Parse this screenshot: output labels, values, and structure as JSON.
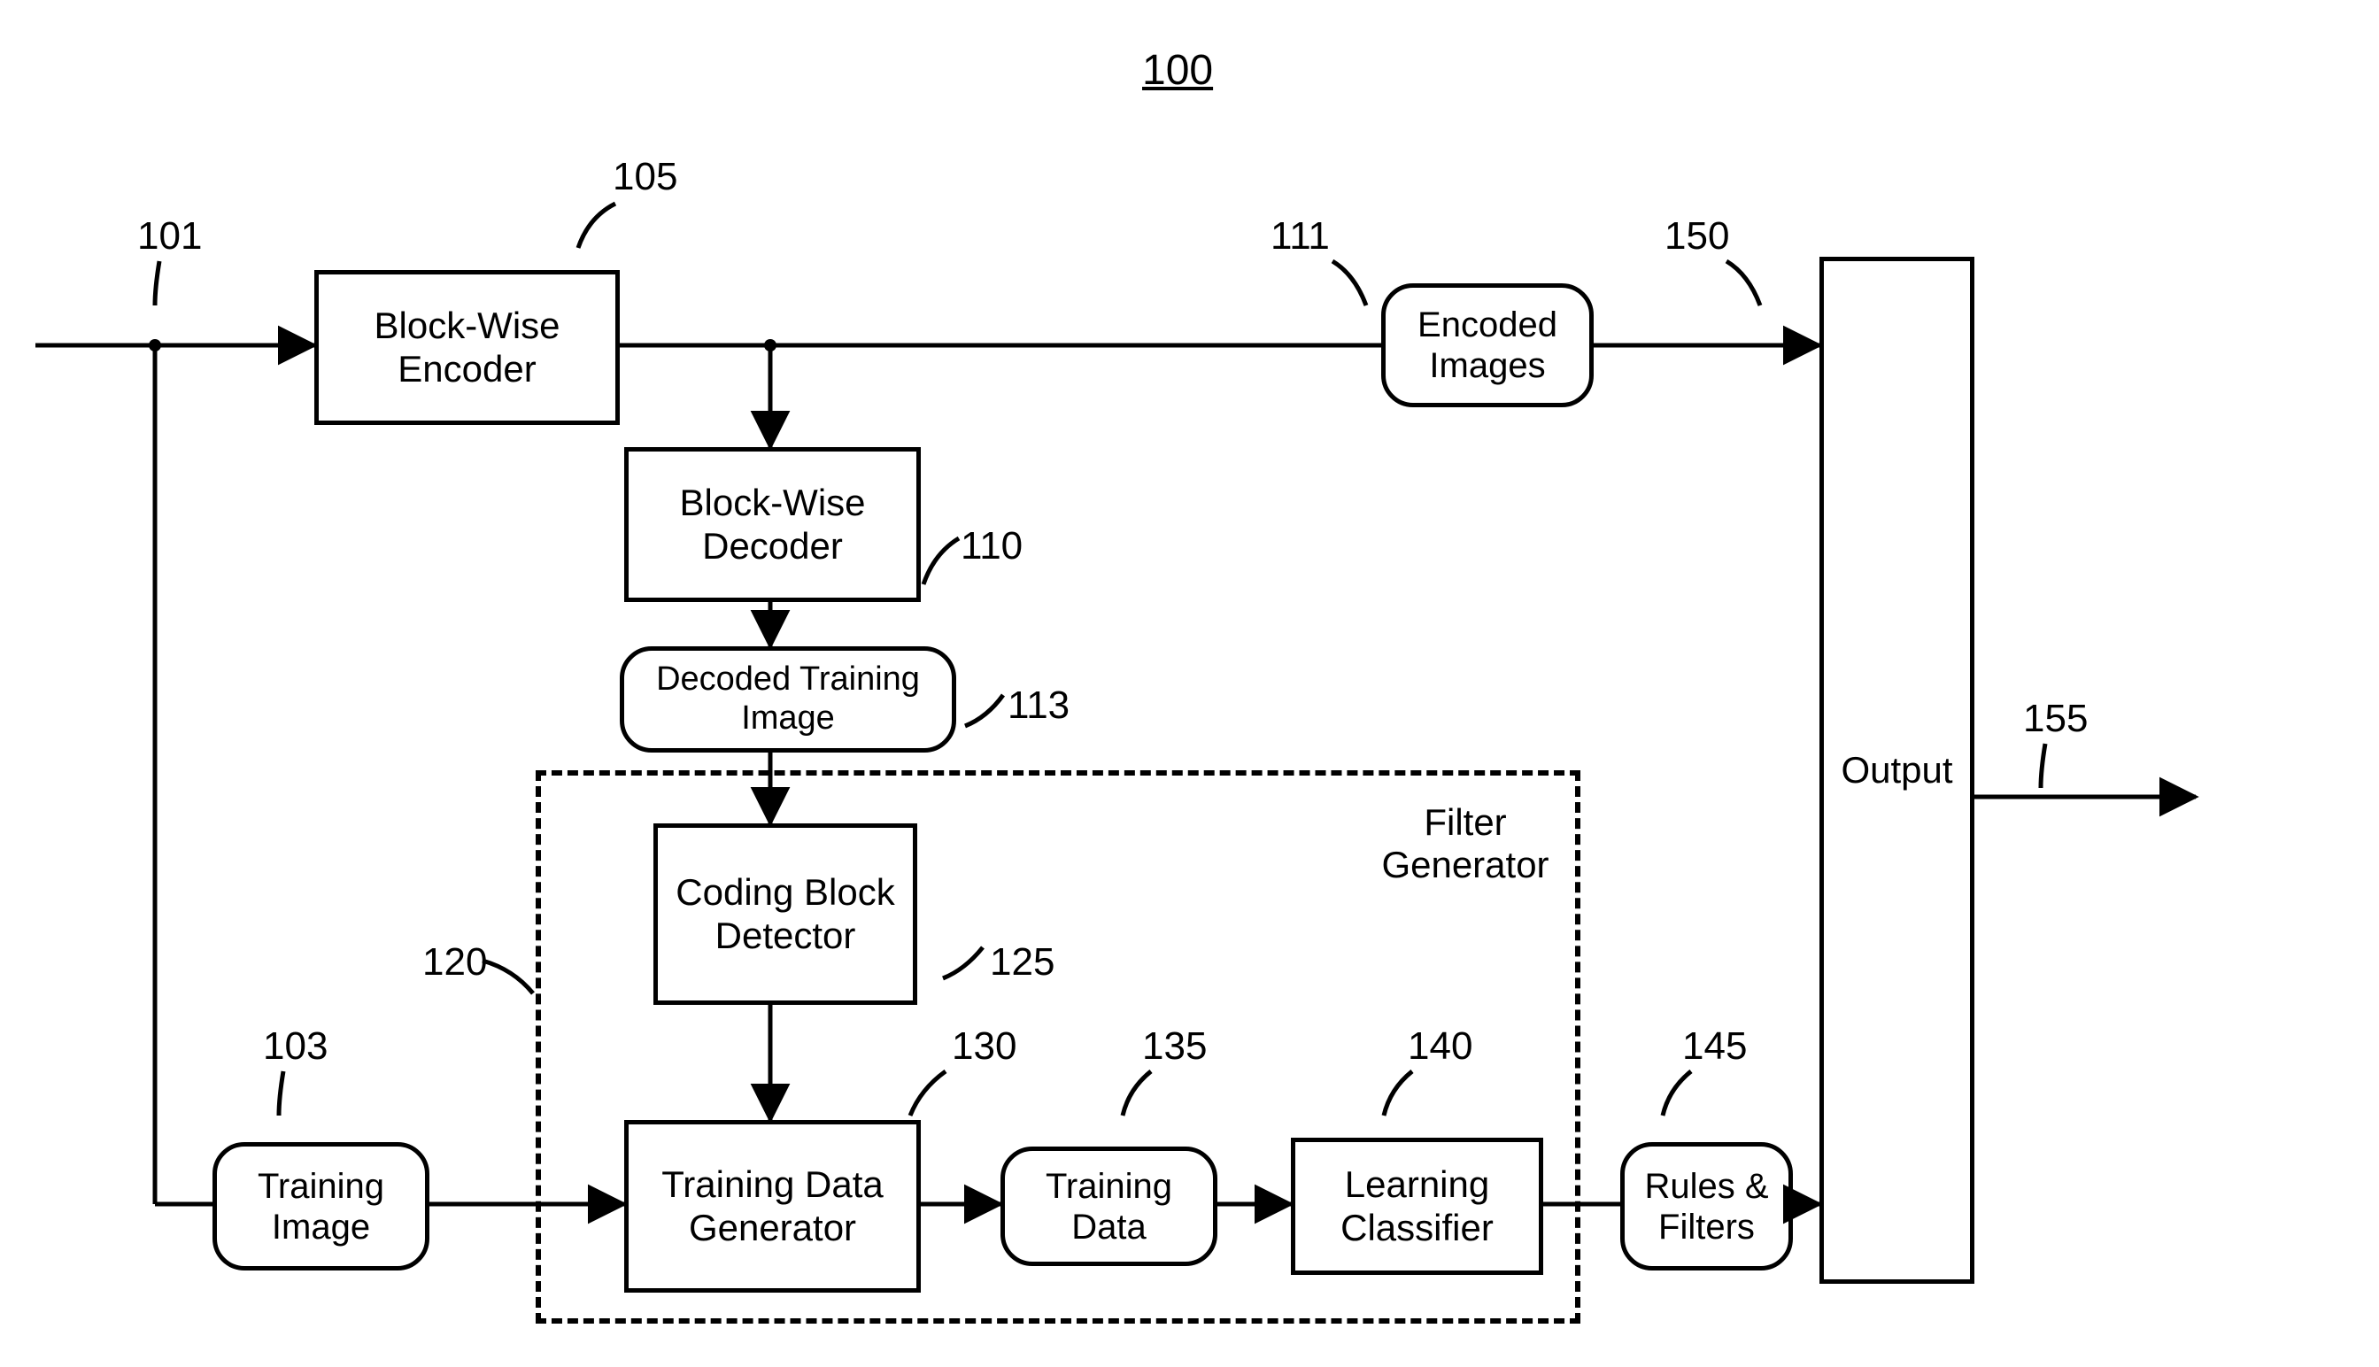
{
  "figure_ref": "100",
  "refs": {
    "input": "101",
    "training_image": "103",
    "encoder": "105",
    "decoder": "110",
    "encoded_images": "111",
    "decoded_training_image": "113",
    "filter_generator": "120",
    "coding_block_detector": "125",
    "training_data_generator": "130",
    "training_data": "135",
    "learning_classifier": "140",
    "rules_filters": "145",
    "output_block": "150",
    "output_signal": "155"
  },
  "blocks": {
    "encoder": "Block-Wise Encoder",
    "decoder": "Block-Wise Decoder",
    "decoded_training_image": "Decoded Training Image",
    "coding_block_detector": "Coding Block Detector",
    "training_data_generator": "Training Data Generator",
    "training_image": "Training Image",
    "training_data": "Training Data",
    "learning_classifier": "Learning Classifier",
    "rules_filters": "Rules & Filters",
    "encoded_images": "Encoded Images",
    "output": "Output",
    "filter_generator_label": "Filter Generator"
  }
}
